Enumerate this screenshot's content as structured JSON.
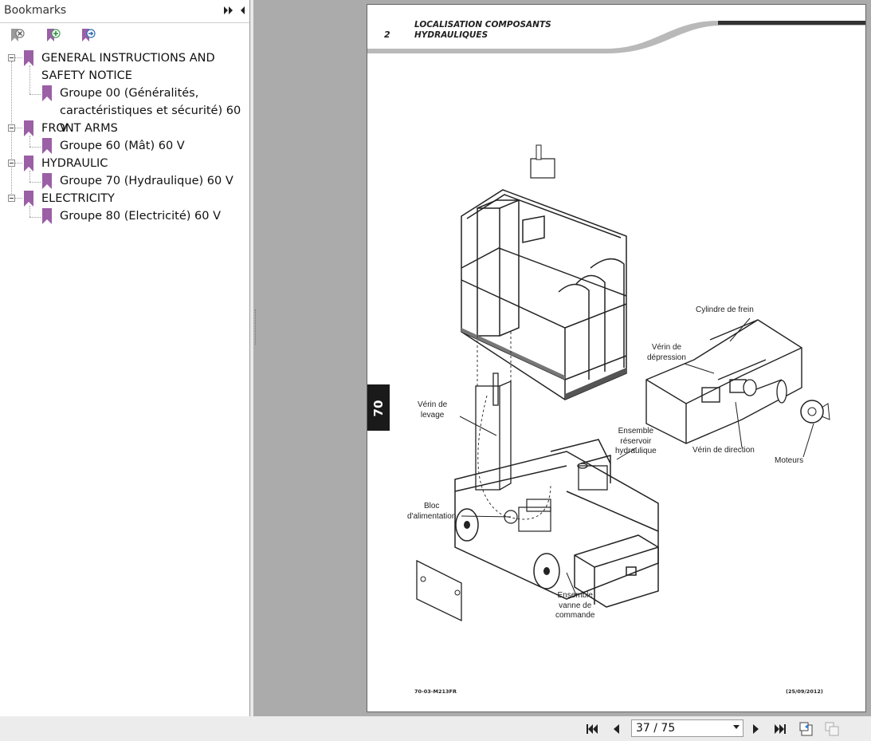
{
  "sidebar": {
    "title": "Bookmarks",
    "tools": [
      "delete-bookmark-icon",
      "add-bookmark-icon",
      "goto-bookmark-icon"
    ],
    "accent": "#9b5fa5",
    "items": [
      {
        "label1": "GENERAL INSTRUCTIONS AND",
        "label2": "SAFETY NOTICE"
      },
      {
        "label1": "Groupe 00 (Généralités,",
        "label2": "caractéristiques et sécurité) 60 V"
      },
      {
        "label1": "FRONT ARMS"
      },
      {
        "label1": "Groupe 60 (Mât) 60 V"
      },
      {
        "label1": "HYDRAULIC"
      },
      {
        "label1": "Groupe 70 (Hydraulique) 60 V"
      },
      {
        "label1": "ELECTRICITY"
      },
      {
        "label1": "Groupe 80 (Electricité) 60 V"
      }
    ]
  },
  "document": {
    "page_number": "2",
    "header_line1": "LOCALISATION COMPOSANTS",
    "header_line2": "HYDRAULIQUES",
    "side_tab": "70",
    "labels": {
      "cylindre_frein": "Cylindre de frein",
      "verin_depression_1": "Vérin de",
      "verin_depression_2": "dépression",
      "verin_levage_1": "Vérin de",
      "verin_levage_2": "levage",
      "ensemble_reservoir_1": "Ensemble",
      "ensemble_reservoir_2": "réservoir",
      "ensemble_reservoir_3": "hydraulique",
      "verin_direction": "Vérin de direction",
      "moteurs": "Moteurs",
      "bloc_1": "Bloc",
      "bloc_2": "d'alimentation",
      "vanne_1": "Ensemble",
      "vanne_2": "vanne de",
      "vanne_3": "commande"
    },
    "footer_left": "70-03-M213FR",
    "footer_right": "(25/09/2012)"
  },
  "navigation": {
    "page_display": "37 / 75"
  }
}
